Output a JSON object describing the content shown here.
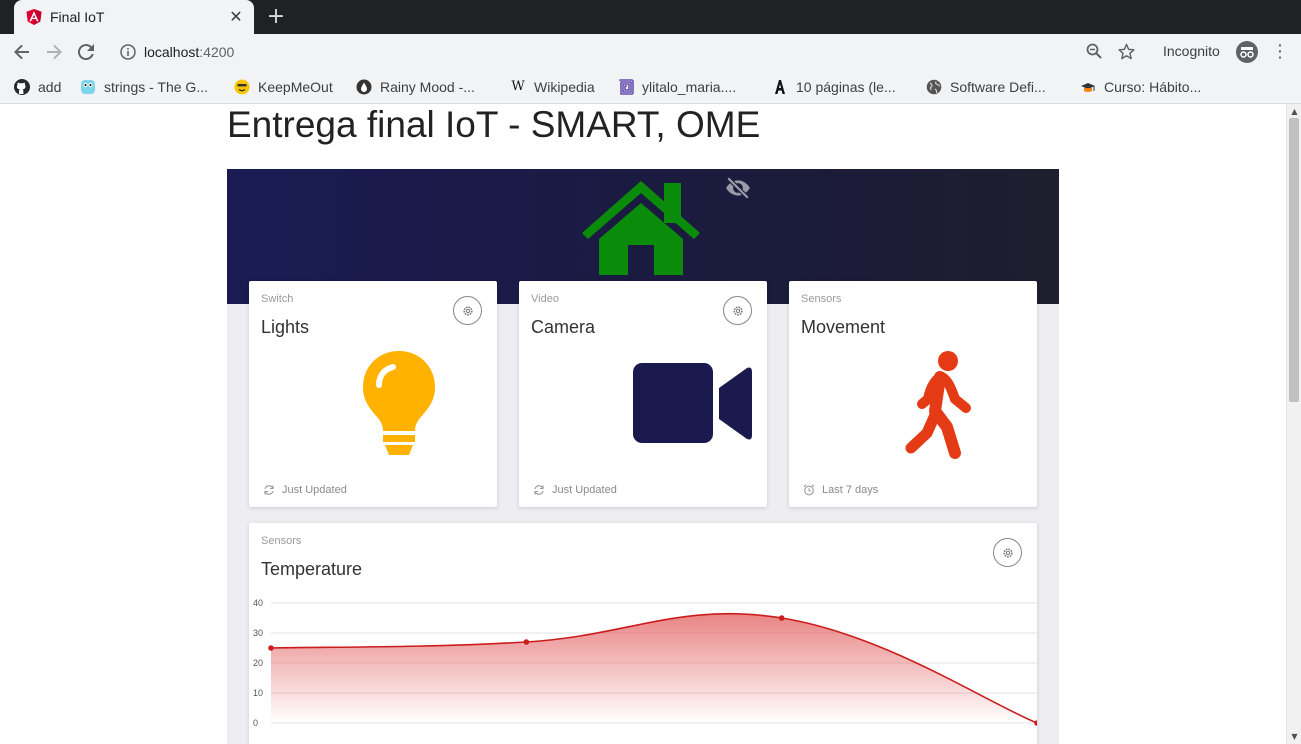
{
  "browser": {
    "tab_title": "Final IoT",
    "url_host": "localhost",
    "url_port": ":4200",
    "profile_label": "Incognito",
    "bookmarks": [
      {
        "label": "add",
        "icon": "github-icon"
      },
      {
        "label": "strings - The G...",
        "icon": "gopher-icon"
      },
      {
        "label": "KeepMeOut",
        "icon": "smiley-icon"
      },
      {
        "label": "Rainy Mood -...",
        "icon": "raindrop-icon"
      },
      {
        "label": "Wikipedia",
        "icon": "wikipedia-icon"
      },
      {
        "label": "ylitalo_maria....",
        "icon": "square-spiral-icon"
      },
      {
        "label": "10 páginas (le...",
        "icon": "a-letter-icon"
      },
      {
        "label": "Software Defi...",
        "icon": "globe-icon"
      },
      {
        "label": "Curso: Hábito...",
        "icon": "graduation-icon"
      }
    ]
  },
  "page": {
    "title": "Entrega final IoT - SMART, OME"
  },
  "cards": {
    "lights": {
      "category": "Switch",
      "title": "Lights",
      "footer": "Just Updated",
      "icon": "lightbulb-icon",
      "color": "#ffb300"
    },
    "camera": {
      "category": "Video",
      "title": "Camera",
      "footer": "Just Updated",
      "icon": "videocam-icon",
      "color": "#1a1a4e"
    },
    "movement": {
      "category": "Sensors",
      "title": "Movement",
      "footer": "Last 7 days",
      "icon": "walking-person-icon",
      "color": "#e43b16"
    },
    "temperature": {
      "category": "Sensors",
      "title": "Temperature"
    }
  },
  "colors": {
    "home_icon": "#0a8c0a",
    "banner": "#1a1b4a",
    "chart_line": "#cc1d1d"
  },
  "chart_data": {
    "type": "area",
    "title": "",
    "xlabel": "",
    "ylabel": "",
    "y_ticks": [
      "0",
      "10",
      "20",
      "30",
      "40"
    ],
    "ylim": [
      0,
      40
    ],
    "series": [
      {
        "values": [
          25,
          27,
          35,
          0
        ]
      }
    ],
    "grid": true,
    "legend": "none"
  }
}
